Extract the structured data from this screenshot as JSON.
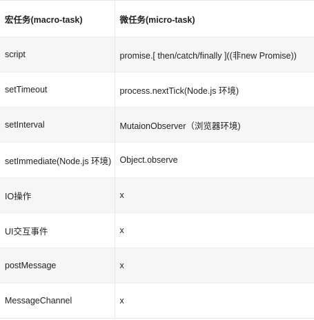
{
  "table": {
    "headers": [
      "宏任务(macro-task)",
      "微任务(micro-task)"
    ],
    "rows": [
      [
        "script",
        "promise.[ then/catch/finally ]((非new Promise))"
      ],
      [
        "setTimeout",
        "process.nextTick(Node.js 环境)"
      ],
      [
        "setInterval",
        "MutaionObserver（浏览器环境)"
      ],
      [
        "setImmediate(Node.js 环境)",
        "Object.observe"
      ],
      [
        "IO操作",
        "x"
      ],
      [
        "UI交互事件",
        "x"
      ],
      [
        "postMessage",
        "x"
      ],
      [
        "MessageChannel",
        "x"
      ]
    ]
  }
}
